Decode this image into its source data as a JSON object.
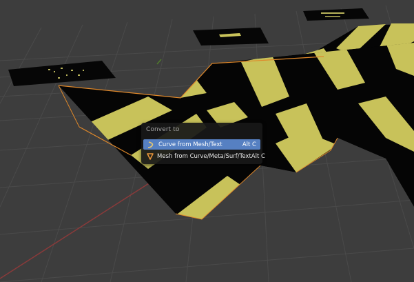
{
  "context_menu": {
    "title": "Convert to",
    "items": [
      {
        "icon": "curve-icon",
        "label": "Curve from Mesh/Text",
        "shortcut": "Alt C",
        "highlighted": true
      },
      {
        "icon": "mesh-icon",
        "label": "Mesh from Curve/Meta/Surf/Text",
        "shortcut": "Alt C",
        "highlighted": false
      }
    ]
  },
  "colors": {
    "viewport_background": "#3d3d3d",
    "grid_line": "#4a4a4a",
    "x_axis": "#8a3a3a",
    "y_axis": "#4f7a2c",
    "stripe_yellow": "#c8c25a",
    "stripe_black": "#050505",
    "selection_outline": "#e0882a",
    "menu_background": "#181818",
    "menu_highlight": "#5680c2",
    "menu_text": "#e6e6e6"
  }
}
